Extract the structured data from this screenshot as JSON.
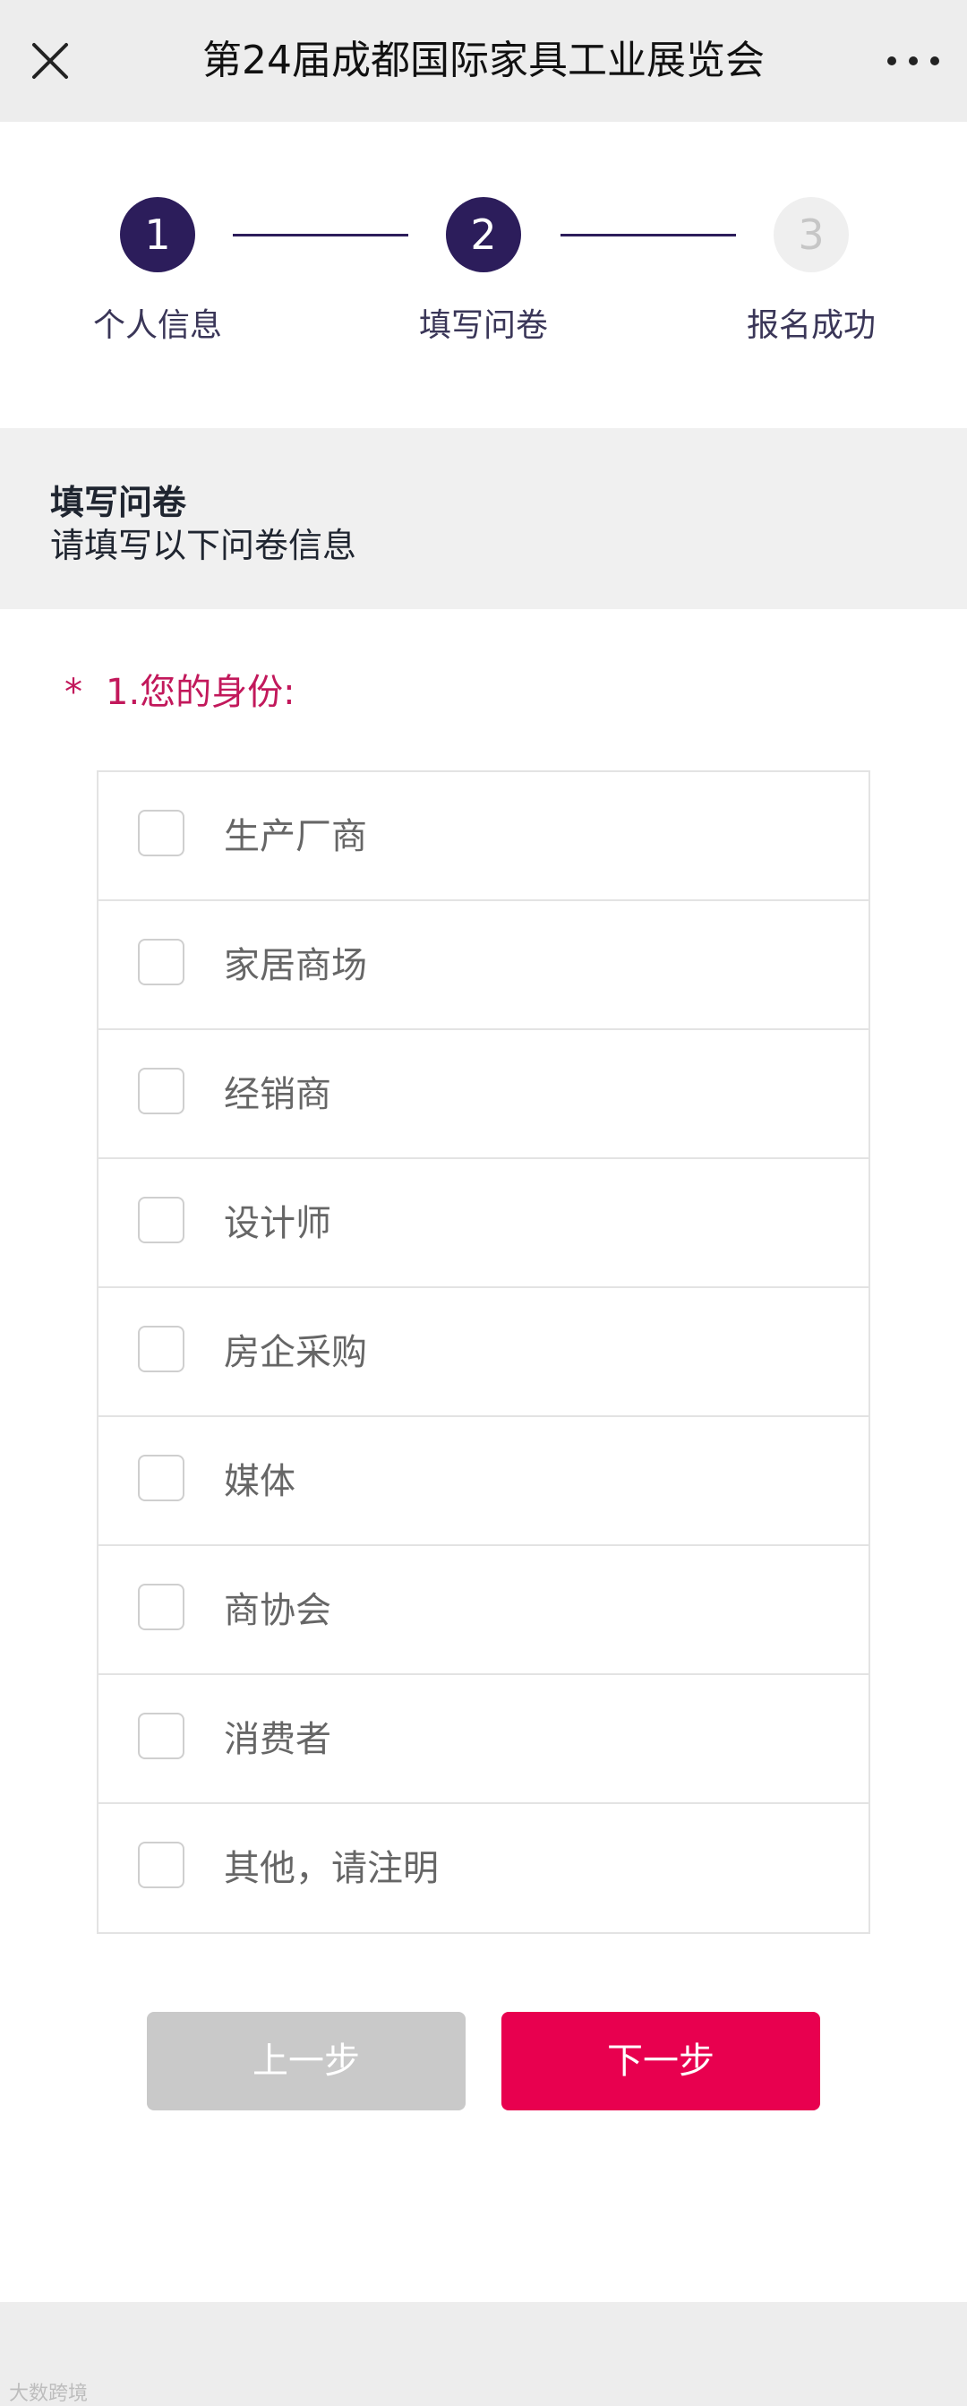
{
  "navbar": {
    "title": "第24届成都国际家具工业展览会",
    "close_icon": "close-icon",
    "more_icon": "more-icon"
  },
  "steps": [
    {
      "number": "1",
      "label": "个人信息",
      "state": "active"
    },
    {
      "number": "2",
      "label": "填写问卷",
      "state": "active"
    },
    {
      "number": "3",
      "label": "报名成功",
      "state": "inactive"
    }
  ],
  "section": {
    "title": "填写问卷",
    "subtitle": "请填写以下问卷信息"
  },
  "question": {
    "required_mark": "*",
    "text": "1.您的身份:",
    "options": [
      {
        "label": "生产厂商",
        "checked": false
      },
      {
        "label": "家居商场",
        "checked": false
      },
      {
        "label": "经销商",
        "checked": false
      },
      {
        "label": "设计师",
        "checked": false
      },
      {
        "label": "房企采购",
        "checked": false
      },
      {
        "label": "媒体",
        "checked": false
      },
      {
        "label": "商协会",
        "checked": false
      },
      {
        "label": "消费者",
        "checked": false
      },
      {
        "label": "其他，请注明",
        "checked": false
      }
    ]
  },
  "buttons": {
    "prev_label": "上一步",
    "next_label": "下一步"
  },
  "watermark": "大数跨境",
  "colors": {
    "step_active": "#2c1d5b",
    "step_inactive": "#efefef",
    "question": "#c2185b",
    "next_button": "#e8004f",
    "prev_button": "#c9c9c9"
  }
}
